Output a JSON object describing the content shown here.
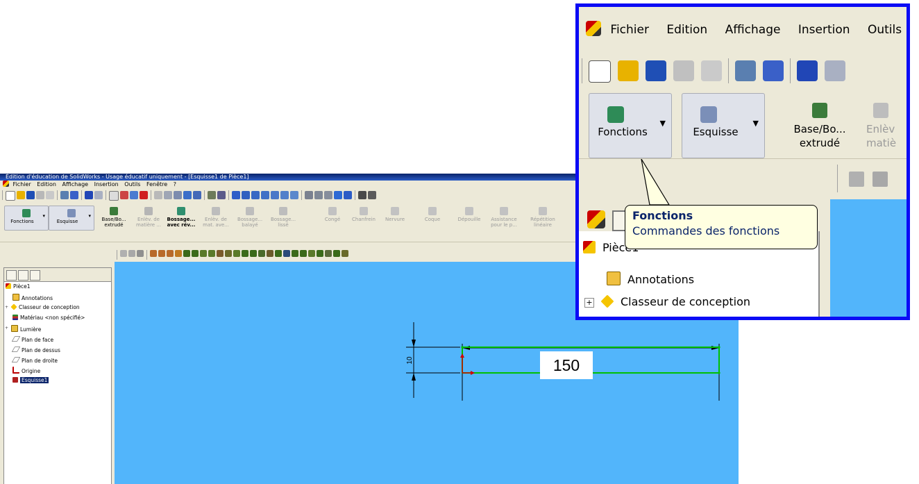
{
  "window": {
    "title": "Édition d'éducation de SolidWorks - Usage éducatif uniquement - [Esquisse1 de Pièce1]"
  },
  "menu": [
    "Fichier",
    "Edition",
    "Affichage",
    "Insertion",
    "Outils",
    "Fenêtre",
    "?"
  ],
  "command_manager": {
    "tab_fonctions": "Fonctions",
    "tab_esquisse": "Esquisse",
    "commands": [
      {
        "line1": "Base/Bo...",
        "line2": "extrudé",
        "enabled": true
      },
      {
        "line1": "Enlèv. de",
        "line2": "matière ...",
        "enabled": false
      },
      {
        "line1": "Bossage...",
        "line2": "avec rév...",
        "enabled": true
      },
      {
        "line1": "Enlèv. de",
        "line2": "mat. ave...",
        "enabled": false
      },
      {
        "line1": "Bossage...",
        "line2": "balayé",
        "enabled": false
      },
      {
        "line1": "Bossage...",
        "line2": "lissé",
        "enabled": false
      },
      {
        "line1": "Congé",
        "line2": "",
        "enabled": false
      },
      {
        "line1": "Chanfrein",
        "line2": "",
        "enabled": false
      },
      {
        "line1": "Nervure",
        "line2": "",
        "enabled": false
      },
      {
        "line1": "Coque",
        "line2": "",
        "enabled": false
      },
      {
        "line1": "Dépouille",
        "line2": "",
        "enabled": false
      },
      {
        "line1": "Assistance",
        "line2": "pour le p...",
        "enabled": false
      },
      {
        "line1": "Répétition",
        "line2": "linéaire",
        "enabled": false
      }
    ]
  },
  "feature_tree": {
    "root": "Pièce1",
    "items": [
      "Annotations",
      "Classeur de conception",
      "Matériau <non spécifié>",
      "Lumière",
      "Plan de face",
      "Plan de dessus",
      "Plan de droite",
      "Origine",
      "Esquisse1"
    ]
  },
  "sketch": {
    "width_dimension": "150",
    "height_dimension": "10",
    "line_color": "#00c000",
    "background_color": "#52b5fb"
  },
  "zoom": {
    "menu": [
      "Fichier",
      "Edition",
      "Affichage",
      "Insertion",
      "Outils"
    ],
    "tab_fonctions": "Fonctions",
    "tab_esquisse": "Esquisse",
    "cmd1_line1": "Base/Bo...",
    "cmd1_line2": "extrudé",
    "cmd2_line1": "Enlèv",
    "cmd2_line2": "matiè",
    "tooltip_title": "Fonctions",
    "tooltip_desc": "Commandes des fonctions",
    "tree_root": "Pièce1",
    "tree_items": [
      "Annotations",
      "Classeur de conception"
    ],
    "border_color": "#0b0bf5"
  }
}
